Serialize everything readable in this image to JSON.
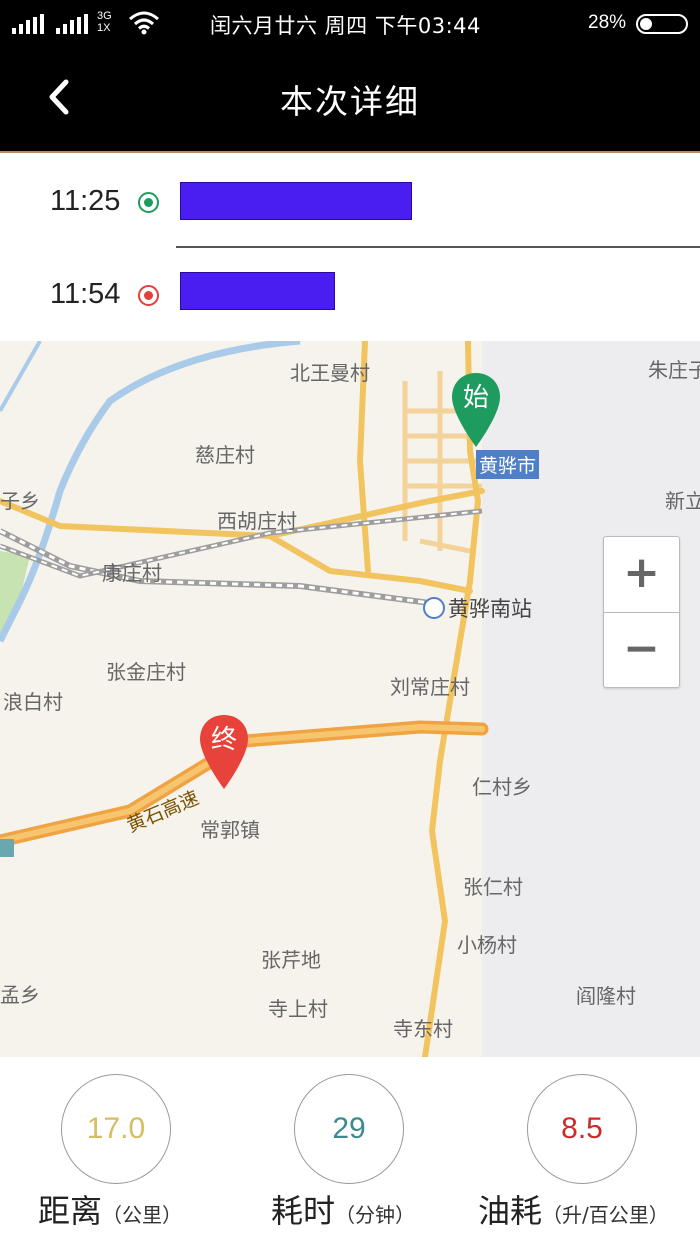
{
  "status_bar": {
    "network_type": "3G",
    "network_sub": "1X",
    "date_time": "闰六月廿六  周四  下午03:44",
    "battery_percent": "28%"
  },
  "nav": {
    "title": "本次详细",
    "back_icon": "chevron-left-icon"
  },
  "route": {
    "start_time": "11:25",
    "end_time": "11:54",
    "start_color": "#1e9b5f",
    "end_color": "#e0413a"
  },
  "map": {
    "labels": {
      "beiwangman": "北王曼村",
      "zhuzhuang": "朱庄子",
      "cizhuang": "慈庄村",
      "zixiang": "子乡",
      "xinli": "新立",
      "xihuzhuang": "西胡庄村",
      "kangzhuang": "康庄村",
      "zhangjinzhuang": "张金庄村",
      "liuchangzhuang": "刘常庄村",
      "langbai": "浪白村",
      "rencun": "仁村乡",
      "changguo": "常郭镇",
      "zhangren": "张仁村",
      "xiaoyang": "小杨村",
      "zhangqiandi": "张芹地",
      "yanlong": "阎隆村",
      "mengxiang": "孟乡",
      "sishang": "寺上村",
      "sidong": "寺东村"
    },
    "city_label": "黄骅市",
    "station_label": "黄骅南站",
    "highway_label": "黄石高速",
    "start_pin": "始",
    "end_pin": "终",
    "zoom_in": "+",
    "zoom_out": "−"
  },
  "stats": {
    "distance": {
      "value": "17.0",
      "label": "距离",
      "unit": "（公里）",
      "color": "#d6bd62"
    },
    "duration": {
      "value": "29",
      "label": "耗时",
      "unit": "（分钟）",
      "color": "#3a8a8f"
    },
    "fuel": {
      "value": "8.5",
      "label": "油耗",
      "unit": "（升/百公里）",
      "color": "#cc2b2b"
    }
  }
}
